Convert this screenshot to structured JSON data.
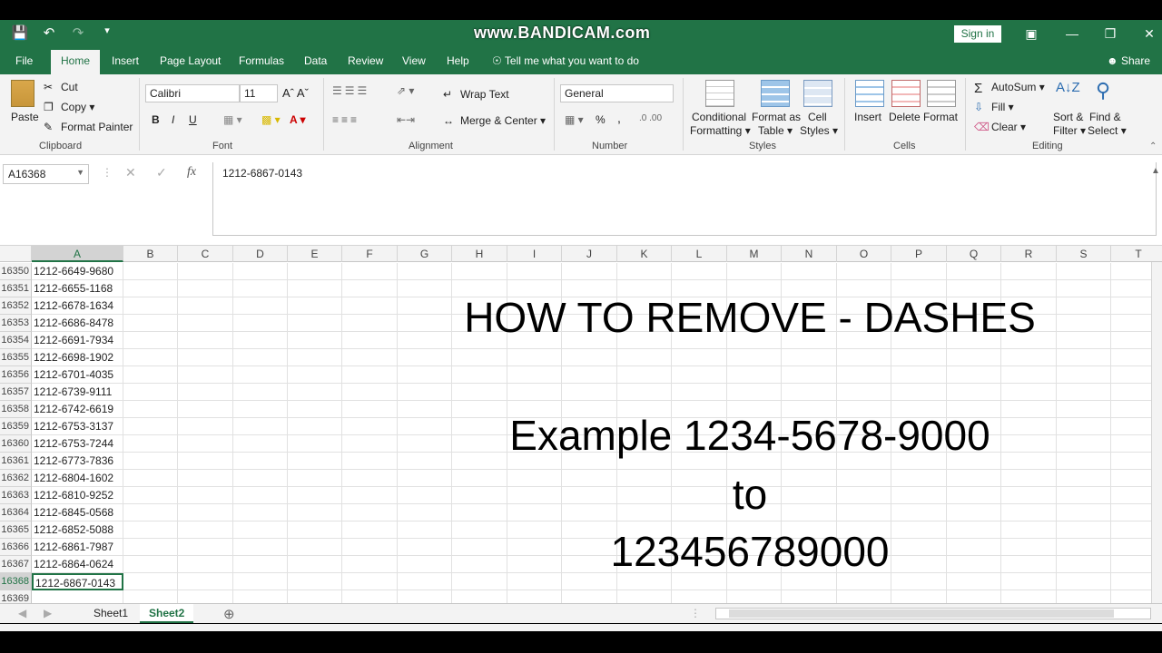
{
  "app": {
    "watermark": "www.BANDICAM.com",
    "sign_in": "Sign in",
    "colors": {
      "excel_green": "#217346",
      "ribbon_bg": "#f3f3f3"
    }
  },
  "tabs": [
    {
      "label": "File"
    },
    {
      "label": "Home"
    },
    {
      "label": "Insert"
    },
    {
      "label": "Page Layout"
    },
    {
      "label": "Formulas"
    },
    {
      "label": "Data"
    },
    {
      "label": "Review"
    },
    {
      "label": "View"
    },
    {
      "label": "Help"
    }
  ],
  "tell_me": "Tell me what you want to do",
  "share": "Share",
  "ribbon": {
    "clipboard": {
      "paste": "Paste",
      "cut": "Cut",
      "copy": "Copy",
      "format_painter": "Format Painter",
      "label": "Clipboard"
    },
    "font": {
      "name": "Calibri",
      "size": "11",
      "bold": "B",
      "italic": "I",
      "underline": "U",
      "label": "Font"
    },
    "alignment": {
      "wrap_text": "Wrap Text",
      "merge_center": "Merge & Center",
      "label": "Alignment"
    },
    "number": {
      "format": "General",
      "percent": "%",
      "comma": ",",
      "label": "Number"
    },
    "styles": {
      "conditional_1": "Conditional",
      "conditional_2": "Formatting",
      "format_table_1": "Format as",
      "format_table_2": "Table",
      "cell_styles_1": "Cell",
      "cell_styles_2": "Styles",
      "label": "Styles"
    },
    "cells": {
      "insert": "Insert",
      "delete": "Delete",
      "format": "Format",
      "label": "Cells"
    },
    "editing": {
      "autosum": "AutoSum",
      "fill": "Fill",
      "clear": "Clear",
      "sort_1": "Sort &",
      "sort_2": "Filter",
      "find_1": "Find &",
      "find_2": "Select",
      "label": "Editing"
    }
  },
  "formula_bar": {
    "name_box": "A16368",
    "fx": "fx",
    "content": "1212-6867-0143"
  },
  "columns": [
    "A",
    "B",
    "C",
    "D",
    "E",
    "F",
    "G",
    "H",
    "I",
    "J",
    "K",
    "L",
    "M",
    "N",
    "O",
    "P",
    "Q",
    "R",
    "S",
    "T"
  ],
  "rows": [
    {
      "num": "16350",
      "a": "1212-6649-9680"
    },
    {
      "num": "16351",
      "a": "1212-6655-1168"
    },
    {
      "num": "16352",
      "a": "1212-6678-1634"
    },
    {
      "num": "16353",
      "a": "1212-6686-8478"
    },
    {
      "num": "16354",
      "a": "1212-6691-7934"
    },
    {
      "num": "16355",
      "a": "1212-6698-1902"
    },
    {
      "num": "16356",
      "a": "1212-6701-4035"
    },
    {
      "num": "16357",
      "a": "1212-6739-9111"
    },
    {
      "num": "16358",
      "a": "1212-6742-6619"
    },
    {
      "num": "16359",
      "a": "1212-6753-3137"
    },
    {
      "num": "16360",
      "a": "1212-6753-7244"
    },
    {
      "num": "16361",
      "a": "1212-6773-7836"
    },
    {
      "num": "16362",
      "a": "1212-6804-1602"
    },
    {
      "num": "16363",
      "a": "1212-6810-9252"
    },
    {
      "num": "16364",
      "a": "1212-6845-0568"
    },
    {
      "num": "16365",
      "a": "1212-6852-5088"
    },
    {
      "num": "16366",
      "a": "1212-6861-7987"
    },
    {
      "num": "16367",
      "a": "1212-6864-0624"
    },
    {
      "num": "16368",
      "a": "1212-6867-0143"
    },
    {
      "num": "16369",
      "a": ""
    }
  ],
  "overlay": {
    "title": "HOW TO REMOVE - DASHES",
    "example": "Example 1234-5678-9000",
    "to": "to",
    "result": "123456789000"
  },
  "sheets": [
    {
      "label": "Sheet1"
    },
    {
      "label": "Sheet2"
    }
  ],
  "active_sheet": "Sheet2"
}
